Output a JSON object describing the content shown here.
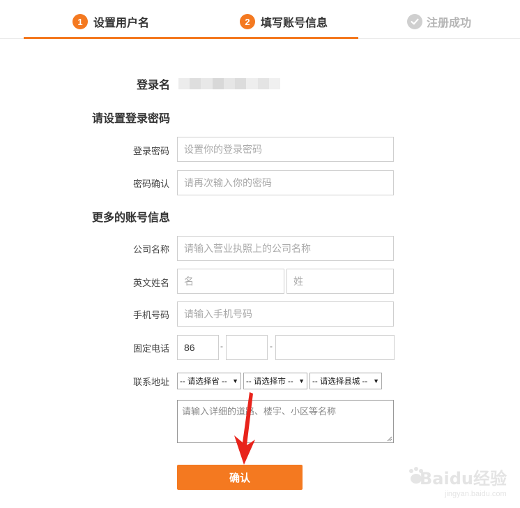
{
  "steps": {
    "step1": {
      "number": "1",
      "label": "设置用户名"
    },
    "step2": {
      "number": "2",
      "label": "填写账号信息"
    },
    "step3": {
      "label": "注册成功"
    }
  },
  "login_name": {
    "label": "登录名"
  },
  "password_section": {
    "title": "请设置登录密码",
    "password": {
      "label": "登录密码",
      "placeholder": "设置你的登录密码"
    },
    "confirm": {
      "label": "密码确认",
      "placeholder": "请再次输入你的密码"
    }
  },
  "more_section": {
    "title": "更多的账号信息",
    "company": {
      "label": "公司名称",
      "placeholder": "请输入营业执照上的公司名称"
    },
    "english_name": {
      "label": "英文姓名",
      "first_placeholder": "名",
      "last_placeholder": "姓"
    },
    "mobile": {
      "label": "手机号码",
      "placeholder": "请输入手机号码"
    },
    "landline": {
      "label": "固定电话",
      "country_code": "86",
      "sep": "-"
    },
    "address": {
      "label": "联系地址",
      "province": "-- 请选择省 --",
      "city": "-- 请选择市 --",
      "county": "-- 请选择县城 --",
      "detail_placeholder": "请输入详细的道路、楼宇、小区等名称"
    }
  },
  "confirm_button": "确认",
  "watermark": {
    "text": "Baidu经验",
    "sub": "jingyan.baidu.com"
  },
  "colors": {
    "accent": "#f47920",
    "inactive": "#b5b5b5",
    "arrow": "#e8231b"
  }
}
